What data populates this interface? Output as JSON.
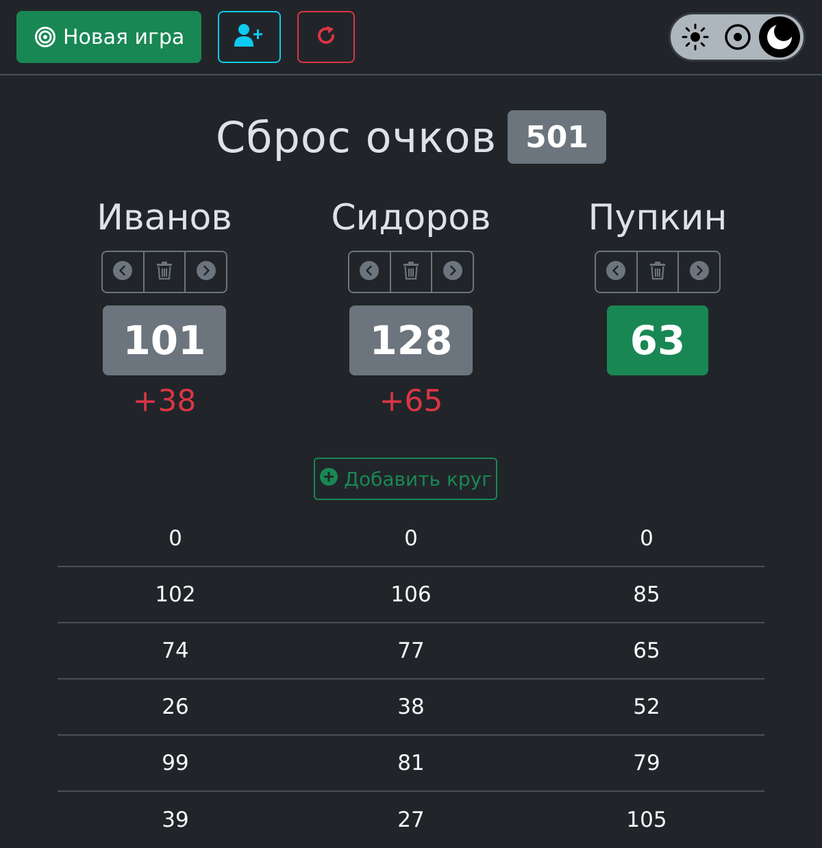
{
  "navbar": {
    "new_game_label": "Новая игра",
    "new_game_icon": "target-icon",
    "add_player_icon": "user-plus-icon",
    "reload_icon": "refresh-icon",
    "theme_options": [
      "sun-icon",
      "auto-icon",
      "moon-icon"
    ],
    "theme_selected": "moon-icon"
  },
  "game": {
    "title": "Сброс очков",
    "target": "501"
  },
  "players": [
    {
      "name": "Иванов",
      "score": "101",
      "delta": "+38",
      "leader": false
    },
    {
      "name": "Сидоров",
      "score": "128",
      "delta": "+65",
      "leader": false
    },
    {
      "name": "Пупкин",
      "score": "63",
      "delta": "",
      "leader": true
    }
  ],
  "add_round_label": "Добавить круг",
  "rounds": [
    [
      "0",
      "0",
      "0"
    ],
    [
      "102",
      "106",
      "85"
    ],
    [
      "74",
      "77",
      "65"
    ],
    [
      "26",
      "38",
      "52"
    ],
    [
      "99",
      "81",
      "79"
    ],
    [
      "39",
      "27",
      "105"
    ]
  ],
  "colors": {
    "background": "#212529",
    "success": "#198754",
    "info": "#0dcaf0",
    "danger": "#dc3545",
    "secondary": "#6c757d"
  }
}
